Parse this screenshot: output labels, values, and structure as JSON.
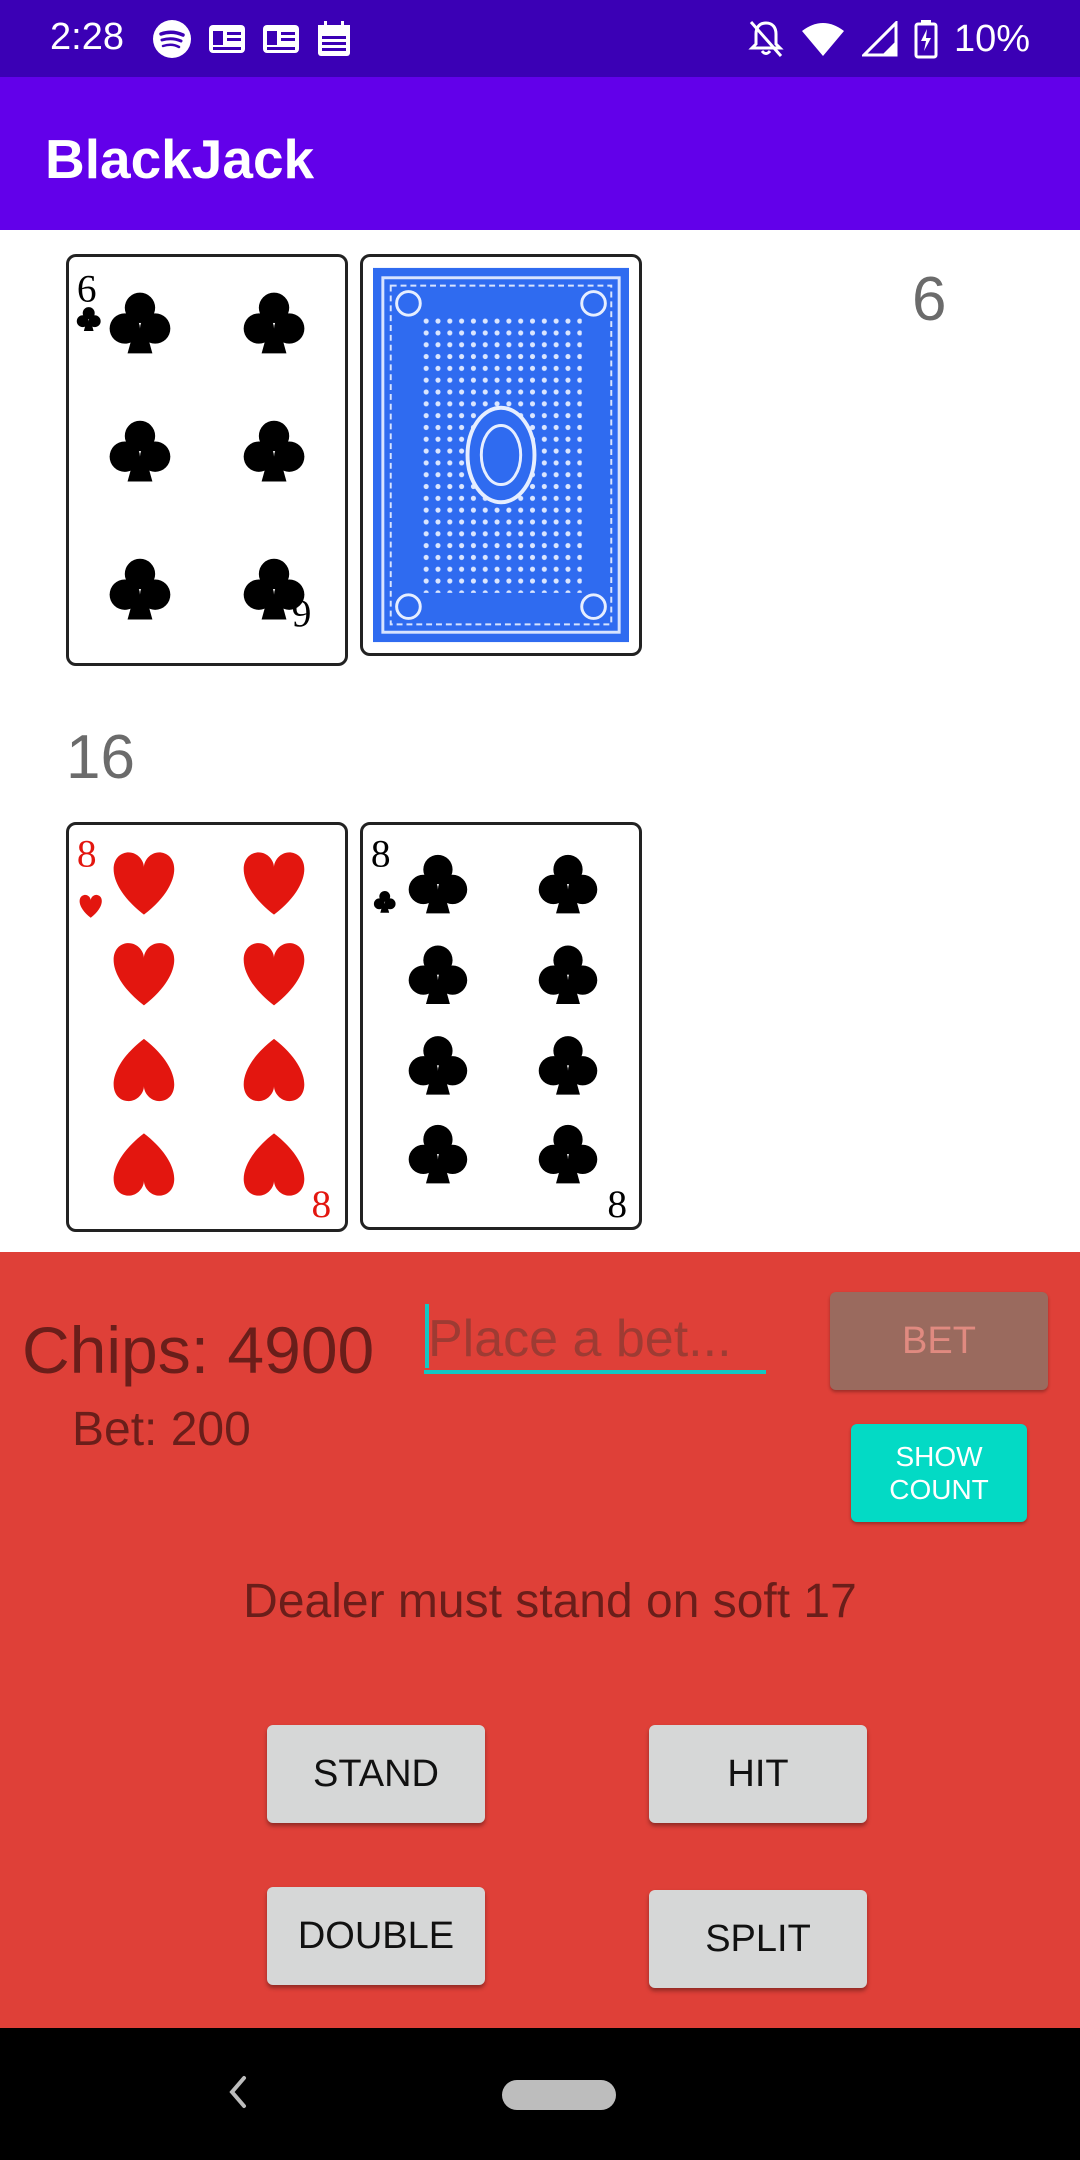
{
  "status_bar": {
    "time": "2:28",
    "battery": "10%",
    "left_icons": [
      "spotify-icon",
      "news-icon",
      "news-icon",
      "calendar-icon"
    ],
    "right_icons": [
      "notifications-off-icon",
      "wifi-icon",
      "signal-icon",
      "battery-icon"
    ]
  },
  "app_bar": {
    "title": "BlackJack"
  },
  "dealer": {
    "score": "6",
    "cards": [
      "6 of clubs",
      "face-down"
    ]
  },
  "player": {
    "score": "16",
    "cards": [
      "8 of hearts",
      "8 of clubs"
    ]
  },
  "table": {
    "chips_label": "Chips: 4900",
    "bet_label": "Bet: 200",
    "bet_placeholder": "Place a bet...",
    "bet_button": "BET",
    "show_count_button": "SHOW COUNT",
    "rule": "Dealer must stand on soft 17",
    "stand_button": "STAND",
    "hit_button": "HIT",
    "double_button": "DOUBLE",
    "split_button": "SPLIT"
  },
  "colors": {
    "status_bar": "#3b00b5",
    "app_bar": "#6200ea",
    "table": "#df4038",
    "accent": "#03dac5"
  }
}
